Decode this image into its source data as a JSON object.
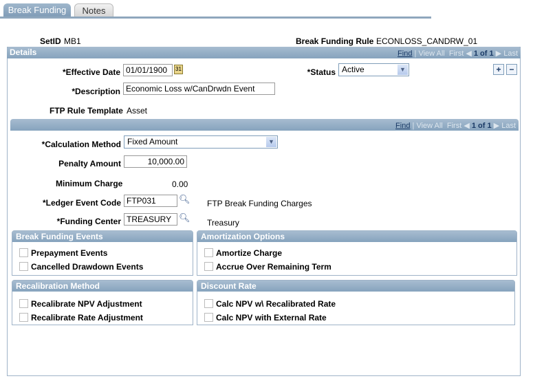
{
  "tabs": [
    {
      "label": "Break Funding",
      "active": true
    },
    {
      "label": "Notes",
      "active": false
    }
  ],
  "header": {
    "setid_label": "SetID",
    "setid_value": "MB1",
    "rule_label": "Break Funding Rule",
    "rule_value": "ECONLOSS_CANDRW_01"
  },
  "details": {
    "title": "Details",
    "nav": {
      "find": "Find",
      "view_all": "View All",
      "first": "First",
      "count": "1 of 1",
      "last": "Last"
    },
    "effective_date_label": "*Effective Date",
    "effective_date": "01/01/1900",
    "status_label": "*Status",
    "status": "Active",
    "description_label": "*Description",
    "description": "Economic Loss w/CanDrwdn Event",
    "template_label": "FTP Rule Template",
    "template_value": "Asset"
  },
  "sub": {
    "nav": {
      "find": "Find",
      "view_all": "View All",
      "first": "First",
      "count": "1 of 1",
      "last": "Last"
    },
    "calc_label": "*Calculation Method",
    "calc": "Fixed Amount",
    "penalty_label": "Penalty Amount",
    "penalty": "10,000.00",
    "min_label": "Minimum Charge",
    "min": "0.00",
    "ledger_label": "*Ledger Event Code",
    "ledger": "FTP031",
    "ledger_desc": "FTP Break Funding Charges",
    "center_label": "*Funding Center",
    "center": "TREASURY",
    "center_desc": "Treasury"
  },
  "groups": [
    {
      "title": "Break Funding Events",
      "items": [
        "Prepayment Events",
        "Cancelled Drawdown Events"
      ]
    },
    {
      "title": "Amortization Options",
      "items": [
        "Amortize Charge",
        "Accrue Over Remaining Term"
      ]
    },
    {
      "title": "Recalibration Method",
      "items": [
        "Recalibrate NPV Adjustment",
        "Recalibrate Rate Adjustment"
      ]
    },
    {
      "title": "Discount Rate",
      "items": [
        "Calc NPV w\\ Recalibrated Rate",
        "Calc NPV with External Rate"
      ]
    }
  ],
  "colors": {
    "header": "#8eaac3",
    "link": "#1a3a66"
  }
}
